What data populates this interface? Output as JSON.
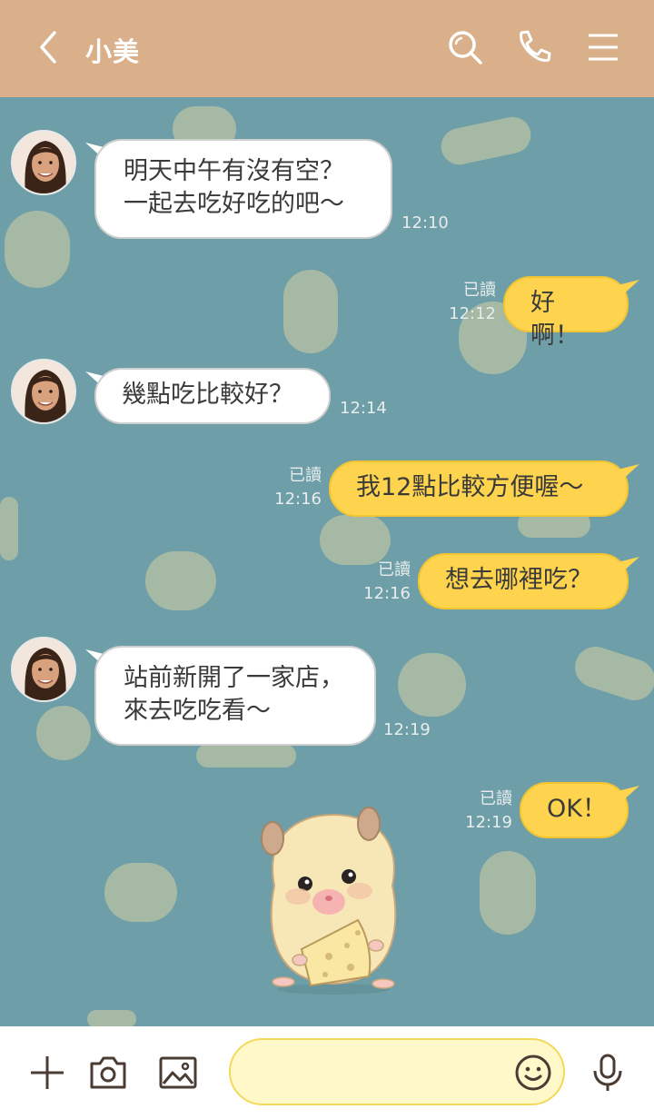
{
  "header": {
    "contact_name": "小美",
    "back_icon": "chevron-left-icon",
    "search_icon": "search-icon",
    "call_icon": "phone-icon",
    "menu_icon": "menu-icon",
    "background_color": "#d9b08a"
  },
  "chat": {
    "background_color": "#6e9fa8",
    "messages": [
      {
        "side": "left",
        "lines": [
          "明天中午有沒有空？",
          "一起去吃好吃的吧～"
        ],
        "time": "12:10"
      },
      {
        "side": "right",
        "text": "好啊！",
        "read": "已讀",
        "time": "12:12"
      },
      {
        "side": "left",
        "text": "幾點吃比較好？",
        "time": "12:14"
      },
      {
        "side": "right",
        "text": "我12點比較方便喔～",
        "read": "已讀",
        "time": "12:16"
      },
      {
        "side": "right",
        "text": "想去哪裡吃？",
        "read": "已讀",
        "time": "12:16"
      },
      {
        "side": "left",
        "lines": [
          "站前新開了一家店，",
          "來去吃吃看～"
        ],
        "time": "12:19"
      },
      {
        "side": "right",
        "text": "OK！",
        "read": "已讀",
        "time": "12:19"
      },
      {
        "side": "right",
        "sticker": "hamster-with-cheese"
      }
    ],
    "bubble_colors": {
      "incoming": "#ffffff",
      "outgoing": "#fed44e"
    }
  },
  "footer": {
    "add_icon": "plus-icon",
    "camera_icon": "camera-icon",
    "image_icon": "image-icon",
    "emoji_icon": "smiley-icon",
    "mic_icon": "microphone-icon",
    "input_value": "",
    "input_placeholder": ""
  }
}
